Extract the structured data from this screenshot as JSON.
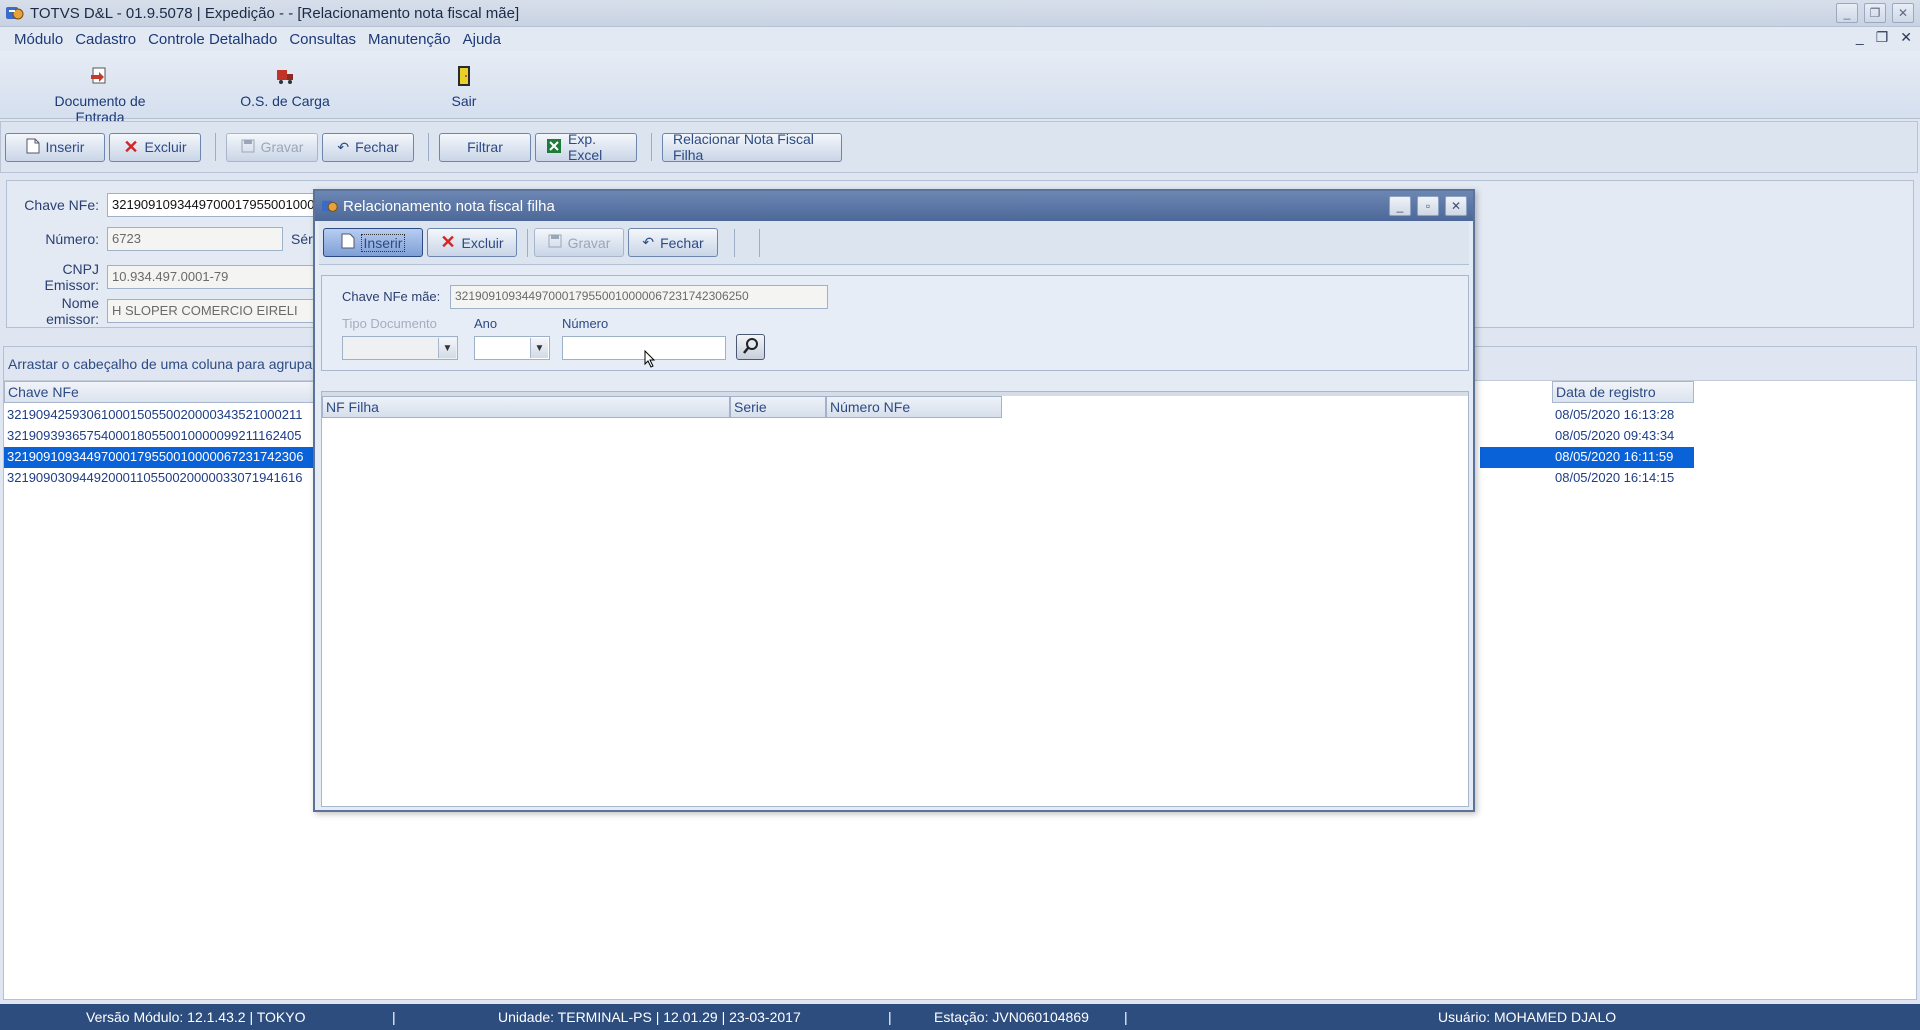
{
  "window": {
    "title": "TOTVS D&L - 01.9.5078 | Expedição - - [Relacionamento nota fiscal mãe]",
    "controls": [
      "_",
      "❐",
      "✕"
    ]
  },
  "menu": {
    "items": [
      "Módulo",
      "Cadastro",
      "Controle Detalhado",
      "Consultas",
      "Manutenção",
      "Ajuda"
    ],
    "mdi_controls": [
      "_",
      "❐",
      "✕"
    ]
  },
  "quick_launch": {
    "items": [
      {
        "label": "Documento de Entrada",
        "icon": "document-entry-icon"
      },
      {
        "label": "O.S. de Carga",
        "icon": "truck-icon"
      },
      {
        "label": "Sair",
        "icon": "exit-door-icon"
      }
    ]
  },
  "toolbar": {
    "insert": "Inserir",
    "delete": "Excluir",
    "save": "Gravar",
    "close": "Fechar",
    "filter": "Filtrar",
    "excel": "Exp. Excel",
    "relate": "Relacionar Nota Fiscal Filha"
  },
  "form": {
    "chave_label": "Chave NFe:",
    "chave_value": "32190910934497000179550010000",
    "numero_label": "Número:",
    "numero_value": "6723",
    "serie_label": "Sér",
    "cnpj_label": "CNPJ Emissor:",
    "cnpj_value": "10.934.497.0001-79",
    "nome_label": "Nome emissor:",
    "nome_value": "H SLOPER COMERCIO EIRELI"
  },
  "grid": {
    "group_hint": "Arrastar o cabeçalho de uma coluna para agrupar p",
    "col_chave": "Chave NFe",
    "col_data": "Data de registro",
    "rows": [
      {
        "chave": "32190942593061000150550020000343521000211",
        "data": "08/05/2020 16:13:28",
        "selected": false
      },
      {
        "chave": "32190939365754000180550010000099211162405",
        "data": "08/05/2020 09:43:34",
        "selected": false
      },
      {
        "chave": "32190910934497000179550010000067231742306",
        "data": "08/05/2020 16:11:59",
        "selected": true
      },
      {
        "chave": "32190903094492000110550020000033071941616",
        "data": "08/05/2020 16:14:15",
        "selected": false
      }
    ]
  },
  "dialog": {
    "title": "Relacionamento nota fiscal filha",
    "controls": [
      "_",
      "▫",
      "✕"
    ],
    "insert": "Inserir",
    "delete": "Excluir",
    "save": "Gravar",
    "close": "Fechar",
    "chave_mae_label": "Chave NFe mãe:",
    "chave_mae_value": "32190910934497000179550010000067231742306250",
    "tipo_doc_label": "Tipo Documento",
    "ano_label": "Ano",
    "numero_label": "Número",
    "numero_value": "",
    "grid_cols": [
      "NF Filha",
      "Serie",
      "Número NFe"
    ]
  },
  "status": {
    "versao": "Versão Módulo:  12.1.43.2  |  TOKYO",
    "unidade": "Unidade: TERMINAL-PS | 12.01.29 | 23-03-2017",
    "estacao": "Estação: JVN060104869",
    "usuario": "Usuário: MOHAMED DJALO",
    "sep": "|"
  },
  "colors": {
    "accent": "#0a62d8",
    "status_bar": "#2d4d7e",
    "dialog_title": "#4c6898"
  }
}
